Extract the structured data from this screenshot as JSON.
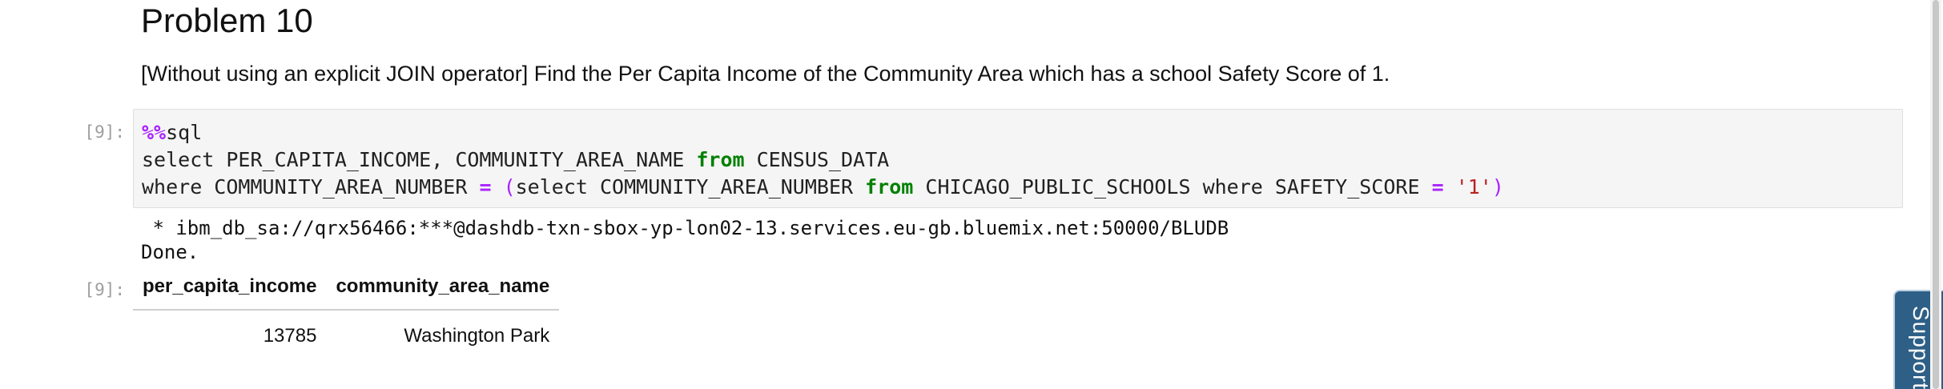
{
  "notebook": {
    "heading": "Problem 10",
    "description": "[Without using an explicit JOIN operator] Find the Per Capita Income of the Community Area which has a school Safety Score of 1.",
    "input_prompt": "[9]:",
    "code": {
      "line1": {
        "magic": "%%",
        "rest": "sql"
      },
      "line2": {
        "a": "select PER_CAPITA_INCOME, COMMUNITY_AREA_NAME ",
        "kw": "from",
        "b": " CENSUS_DATA"
      },
      "line3": {
        "a": "where COMMUNITY_AREA_NUMBER ",
        "eq1": "=",
        "sp1": " ",
        "paren_open": "(",
        "b": "select COMMUNITY_AREA_NUMBER ",
        "kw": "from",
        "c": " CHICAGO_PUBLIC_SCHOOLS where SAFETY_SCORE ",
        "eq2": "=",
        "sp2": " ",
        "str": "'1'",
        "paren_close": ")"
      }
    },
    "output_text": {
      "connection": " * ibm_db_sa://qrx56466:***@dashdb-txn-sbox-yp-lon02-13.services.eu-gb.bluemix.net:50000/BLUDB",
      "done": "Done."
    },
    "output_prompt": "[9]:",
    "result_table": {
      "columns": [
        "per_capita_income",
        "community_area_name"
      ],
      "rows": [
        [
          "13785",
          "Washington Park"
        ]
      ]
    }
  },
  "support_tab": {
    "label": "Support"
  }
}
